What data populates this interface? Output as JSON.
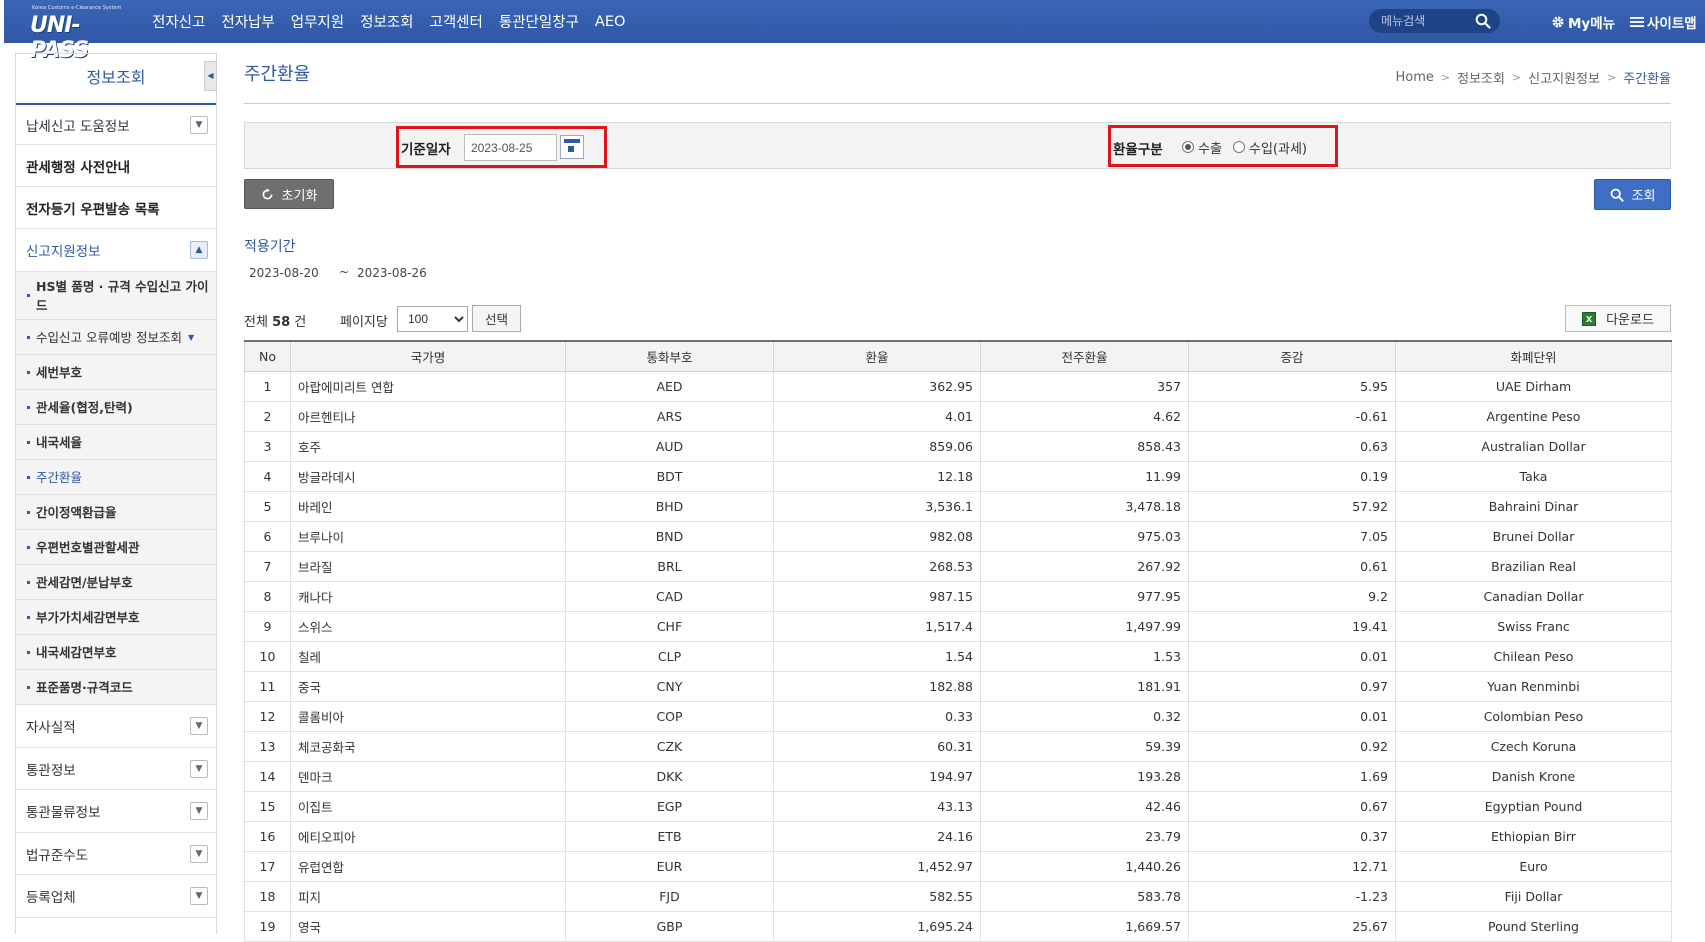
{
  "header": {
    "logo_small": "Korea Customs e-Clearance System",
    "logo_main": "UNI-PASS",
    "nav": [
      "전자신고",
      "전자납부",
      "업무지원",
      "정보조회",
      "고객센터",
      "통관단일창구",
      "AEO"
    ],
    "search_placeholder": "메뉴검색",
    "my_menu": "My메뉴",
    "sitemap": "사이트맵"
  },
  "sidebar": {
    "title": "정보조회",
    "top_items": [
      {
        "label": "납세신고 도움정보",
        "toggle": "down"
      },
      {
        "label": "관세행정 사전안내"
      },
      {
        "label": "전자등기 우편발송 목록"
      }
    ],
    "section": {
      "label": "신고지원정보",
      "toggle": "up"
    },
    "sub_items": [
      "HS별 품명 · 규격 수입신고 가이드",
      "수입신고 오류예방 정보조회",
      "세번부호",
      "관세율(협정,탄력)",
      "내국세율",
      "주간환율",
      "간이정액환급율",
      "우편번호별관할세관",
      "관세감면/분납부호",
      "부가가치세감면부호",
      "내국세감면부호",
      "표준품명·규격코드"
    ],
    "bottom_items": [
      "자사실적",
      "통관정보",
      "통관물류정보",
      "법규준수도",
      "등록업체"
    ]
  },
  "page": {
    "title": "주간환율",
    "breadcrumb": [
      "Home",
      "정보조회",
      "신고지원정보",
      "주간환율"
    ]
  },
  "search": {
    "date_label": "기준일자",
    "date_value": "2023-08-25",
    "rate_label": "환율구분",
    "option_export": "수출",
    "option_import": "수입(과세)",
    "selected": "수출",
    "reset_label": "초기화",
    "search_label": "조회"
  },
  "period": {
    "title": "적용기간",
    "from": "2023-08-20",
    "tilde": "~",
    "to": "2023-08-26"
  },
  "list": {
    "total_prefix": "전체",
    "total_count": "58",
    "total_suffix": "건",
    "per_page_label": "페이지당",
    "per_page_value": "100",
    "select_label": "선택",
    "download_label": "다운로드"
  },
  "table": {
    "headers": [
      "No",
      "국가명",
      "통화부호",
      "환율",
      "전주환율",
      "증감",
      "화폐단위"
    ],
    "rows": [
      [
        "1",
        "아랍에미리트 연합",
        "AED",
        "362.95",
        "357",
        "5.95",
        "UAE Dirham"
      ],
      [
        "2",
        "아르헨티나",
        "ARS",
        "4.01",
        "4.62",
        "-0.61",
        "Argentine Peso"
      ],
      [
        "3",
        "호주",
        "AUD",
        "859.06",
        "858.43",
        "0.63",
        "Australian Dollar"
      ],
      [
        "4",
        "방글라데시",
        "BDT",
        "12.18",
        "11.99",
        "0.19",
        "Taka"
      ],
      [
        "5",
        "바레인",
        "BHD",
        "3,536.1",
        "3,478.18",
        "57.92",
        "Bahraini Dinar"
      ],
      [
        "6",
        "브루나이",
        "BND",
        "982.08",
        "975.03",
        "7.05",
        "Brunei Dollar"
      ],
      [
        "7",
        "브라질",
        "BRL",
        "268.53",
        "267.92",
        "0.61",
        "Brazilian Real"
      ],
      [
        "8",
        "캐나다",
        "CAD",
        "987.15",
        "977.95",
        "9.2",
        "Canadian Dollar"
      ],
      [
        "9",
        "스위스",
        "CHF",
        "1,517.4",
        "1,497.99",
        "19.41",
        "Swiss Franc"
      ],
      [
        "10",
        "칠레",
        "CLP",
        "1.54",
        "1.53",
        "0.01",
        "Chilean Peso"
      ],
      [
        "11",
        "중국",
        "CNY",
        "182.88",
        "181.91",
        "0.97",
        "Yuan Renminbi"
      ],
      [
        "12",
        "콜롬비아",
        "COP",
        "0.33",
        "0.32",
        "0.01",
        "Colombian Peso"
      ],
      [
        "13",
        "체코공화국",
        "CZK",
        "60.31",
        "59.39",
        "0.92",
        "Czech Koruna"
      ],
      [
        "14",
        "덴마크",
        "DKK",
        "194.97",
        "193.28",
        "1.69",
        "Danish Krone"
      ],
      [
        "15",
        "이집트",
        "EGP",
        "43.13",
        "42.46",
        "0.67",
        "Egyptian Pound"
      ],
      [
        "16",
        "에티오피아",
        "ETB",
        "24.16",
        "23.79",
        "0.37",
        "Ethiopian Birr"
      ],
      [
        "17",
        "유럽연합",
        "EUR",
        "1,452.97",
        "1,440.26",
        "12.71",
        "Euro"
      ],
      [
        "18",
        "피지",
        "FJD",
        "582.55",
        "583.78",
        "-1.23",
        "Fiji Dollar"
      ],
      [
        "19",
        "영국",
        "GBP",
        "1,695.24",
        "1,669.57",
        "25.67",
        "Pound Sterling"
      ]
    ]
  },
  "colors": {
    "primary": "#2f58a6",
    "highlight": "#e0141b",
    "reset_button": "#6f6f6f",
    "search_button": "#3e6fc4"
  },
  "icons": {
    "search": "search-icon",
    "gear": "gear-icon",
    "hamburger": "hamburger-icon",
    "calendar": "calendar-icon",
    "refresh": "refresh-icon",
    "excel": "excel-icon"
  }
}
